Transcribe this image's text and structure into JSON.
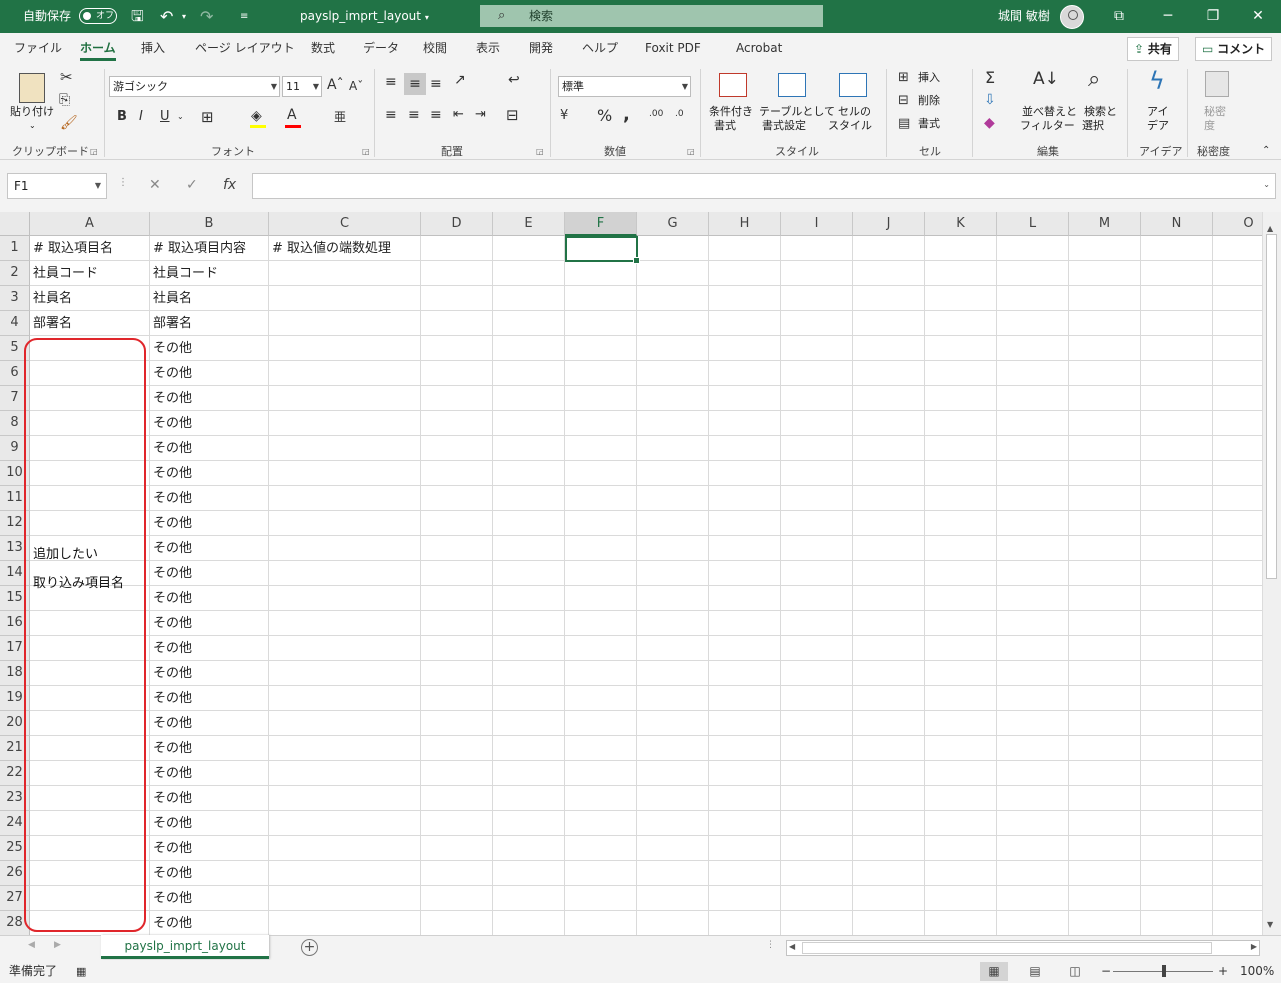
{
  "titlebar": {
    "autosave": "自動保存",
    "autosave_state": "オフ",
    "save_icon": "save-icon",
    "filename": "payslp_imprt_layout",
    "search_placeholder": "検索",
    "user": "城間 敏樹"
  },
  "tabs": [
    "ファイル",
    "ホーム",
    "挿入",
    "ページ レイアウト",
    "数式",
    "データ",
    "校閲",
    "表示",
    "開発",
    "ヘルプ",
    "Foxit PDF",
    "Acrobat"
  ],
  "active_tab": "ホーム",
  "share": "共有",
  "comment": "コメント",
  "ribbon": {
    "clipboard": {
      "paste": "貼り付け",
      "label": "クリップボード"
    },
    "font": {
      "name": "游ゴシック",
      "size": "11",
      "label": "フォント",
      "bold": "B",
      "italic": "I",
      "underline": "U"
    },
    "alignment": {
      "label": "配置"
    },
    "number": {
      "format": "標準",
      "label": "数値"
    },
    "styles": {
      "cond1": "条件付き",
      "cond2": "書式",
      "table1": "テーブルとして",
      "table2": "書式設定",
      "cell1": "セルの",
      "cell2": "スタイル",
      "label": "スタイル"
    },
    "cells": {
      "insert": "挿入",
      "delete": "削除",
      "format": "書式",
      "label": "セル"
    },
    "editing": {
      "sort1": "並べ替えと",
      "sort2": "フィルター",
      "find1": "検索と",
      "find2": "選択",
      "label": "編集"
    },
    "ideas": {
      "l1": "アイ",
      "l2": "デア",
      "label": "アイデア"
    },
    "sensitivity": {
      "l1": "秘密",
      "l2": "度",
      "label": "秘密度"
    }
  },
  "namebox": "F1",
  "columns": [
    "A",
    "B",
    "C",
    "D",
    "E",
    "F",
    "G",
    "H",
    "I",
    "J",
    "K",
    "L",
    "M",
    "N",
    "O"
  ],
  "selected_column": "F",
  "rows": [
    "1",
    "2",
    "3",
    "4",
    "5",
    "6",
    "7",
    "8",
    "9",
    "10",
    "11",
    "12",
    "13",
    "14",
    "15",
    "16",
    "17",
    "18",
    "19",
    "20",
    "21",
    "22",
    "23",
    "24",
    "25",
    "26",
    "27",
    "28"
  ],
  "cells": {
    "A1": "# 取込項目名",
    "B1": "# 取込項目内容",
    "C1": "# 取込値の端数処理",
    "A2": "社員コード",
    "B2": "社員コード",
    "A3": "社員名",
    "B3": "社員名",
    "A4": "部署名",
    "B4": "部署名"
  },
  "b_other": "その他",
  "callout": {
    "line1": "追加したい",
    "line2": "取り込み項目名"
  },
  "sheet_tab": "payslp_imprt_layout",
  "status": {
    "ready": "準備完了",
    "zoom": "100%"
  }
}
